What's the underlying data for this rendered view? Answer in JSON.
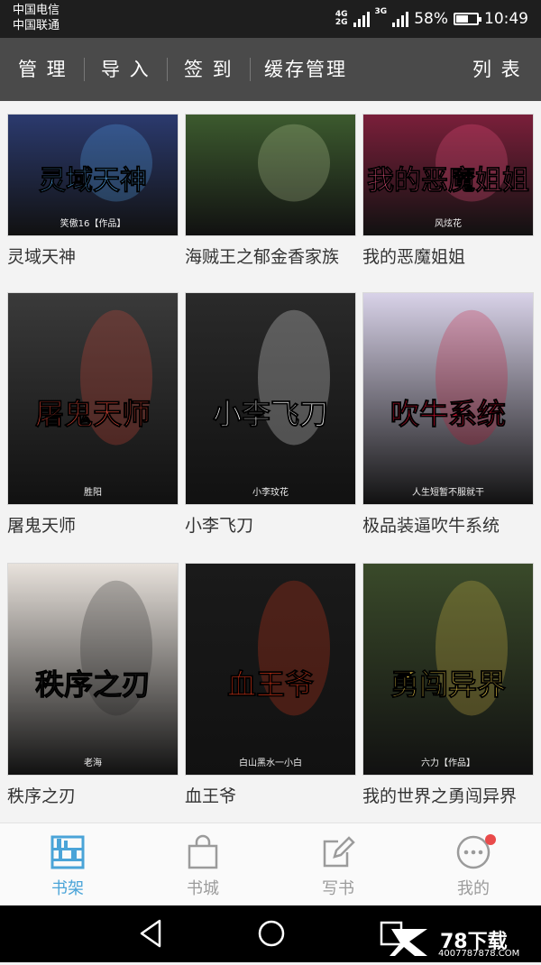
{
  "status_bar": {
    "carrier_1": "中国电信",
    "carrier_2": "中国联通",
    "network_1": "4G",
    "network_2": "2G",
    "network_3": "3G",
    "battery": "58%",
    "battery_level": 0.58,
    "time": "10:49"
  },
  "toolbar": {
    "manage": "管 理",
    "import": "导 入",
    "checkin": "签 到",
    "cache": "缓存管理",
    "list": "列 表"
  },
  "books": [
    {
      "title": "灵域天神",
      "cover_text": "灵域天神",
      "cover_sub": "笑傲16【作品】",
      "bg": "#2b3a6e",
      "accent": "#5ab4ff"
    },
    {
      "title": "海贼王之郁金香家族",
      "cover_text": "",
      "cover_sub": "",
      "bg": "#3c5a2e",
      "accent": "#c9d8a2"
    },
    {
      "title": "我的恶魔姐姐",
      "cover_text": "我的恶魔姐姐",
      "cover_sub": "风炫花",
      "bg": "#7a1f3a",
      "accent": "#ff5a8a"
    },
    {
      "title": "屠鬼天师",
      "cover_text": "屠鬼天师",
      "cover_sub": "胜阳",
      "bg": "#3a3a3a",
      "accent": "#e84a3a"
    },
    {
      "title": "小李飞刀",
      "cover_text": "小李飞刀",
      "cover_sub": "小李玟花",
      "bg": "#2a2a2a",
      "accent": "#ffffff"
    },
    {
      "title": "极品装逼吹牛系统",
      "cover_text": "吹牛系统",
      "cover_sub": "人生短暂不服就干",
      "bg": "#d8d2e8",
      "accent": "#c8102e"
    },
    {
      "title": "秩序之刃",
      "cover_text": "秩序之刃",
      "cover_sub": "老海",
      "bg": "#e8e2dc",
      "accent": "#1a1a1a"
    },
    {
      "title": "血王爷",
      "cover_text": "血王爷",
      "cover_sub": "白山黑水一小白",
      "bg": "#1a1a1a",
      "accent": "#e83a1a"
    },
    {
      "title": "我的世界之勇闯异界",
      "cover_text": "勇闯异界",
      "cover_sub": "六力【作品】",
      "bg": "#3a4a2a",
      "accent": "#e8c84a"
    }
  ],
  "bottom_nav": {
    "bookshelf": "书架",
    "store": "书城",
    "write": "写书",
    "mine": "我的"
  },
  "watermark": {
    "brand": "78下载",
    "url": "4007787878.COM"
  },
  "colors": {
    "accent": "#4aa4d8",
    "toolbar_bg": "#4a4a4a",
    "badge": "#e94a4a"
  }
}
